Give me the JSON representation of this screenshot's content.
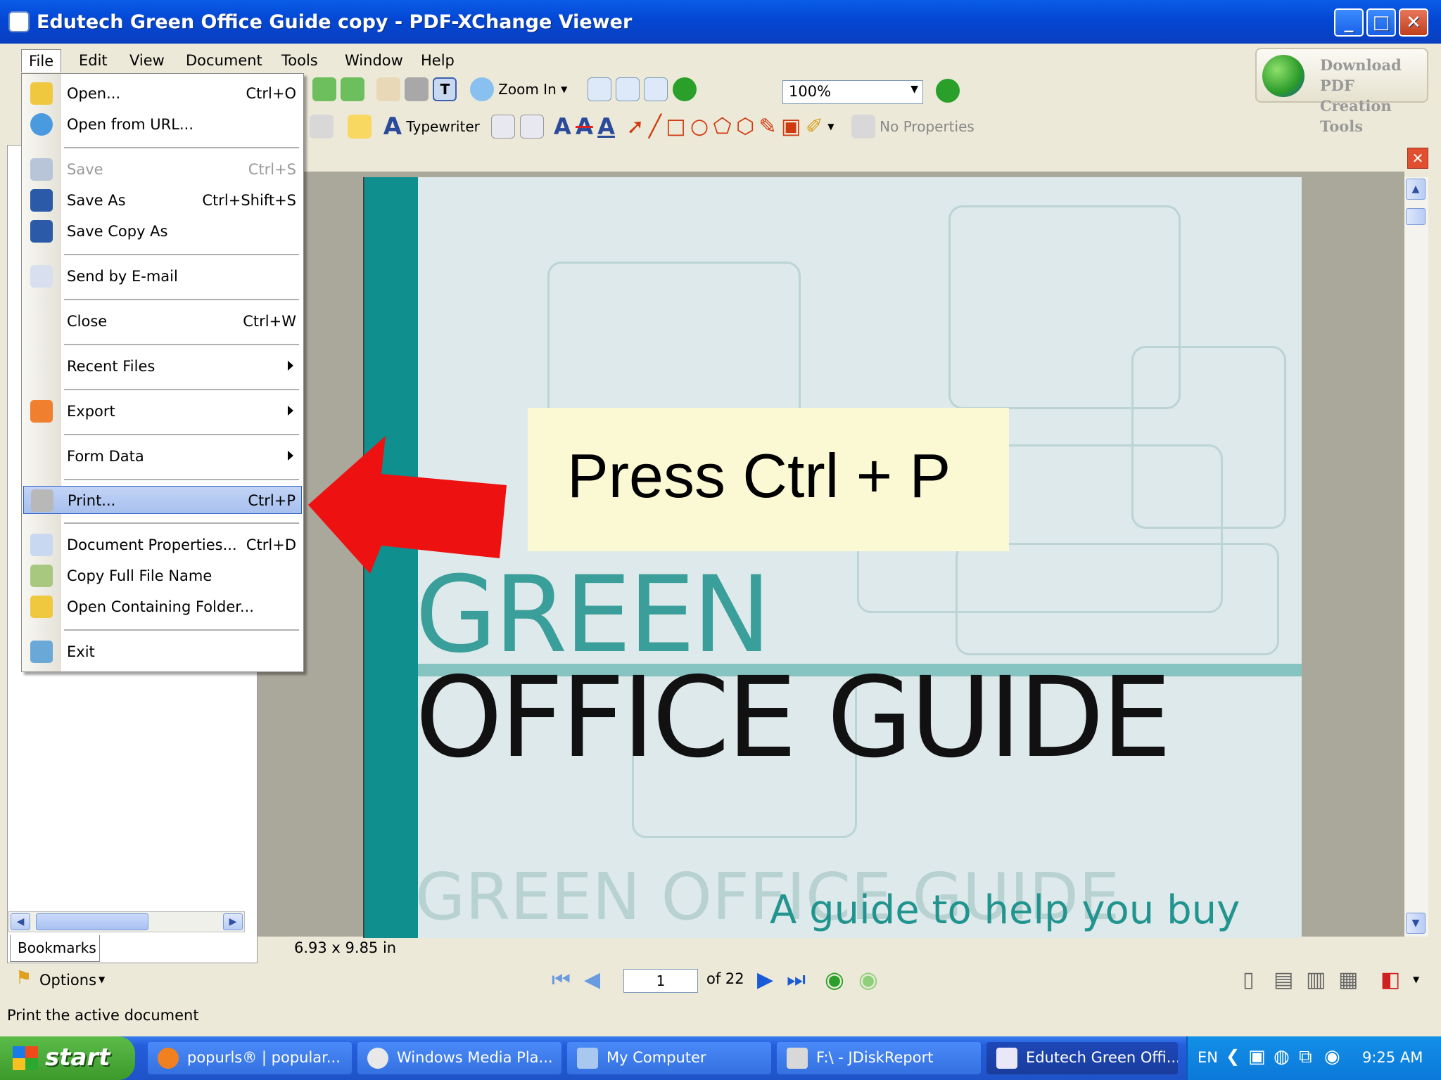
{
  "window": {
    "title": "Edutech Green Office Guide copy - PDF-XChange Viewer"
  },
  "menubar": [
    "File",
    "Edit",
    "View",
    "Document",
    "Tools",
    "Window",
    "Help"
  ],
  "toolbar": {
    "zoom_in_label": "Zoom In",
    "zoom_value": "100%",
    "typewriter_label": "Typewriter",
    "no_properties_label": "No Properties",
    "download_line1": "Download PDF",
    "download_line2": "Creation Tools"
  },
  "file_menu": {
    "open": {
      "label": "Open...",
      "shortcut": "Ctrl+O"
    },
    "open_url": {
      "label": "Open from URL..."
    },
    "save": {
      "label": "Save",
      "shortcut": "Ctrl+S"
    },
    "save_as": {
      "label": "Save As",
      "shortcut": "Ctrl+Shift+S"
    },
    "save_copy_as": {
      "label": "Save Copy As"
    },
    "send_email": {
      "label": "Send by E-mail"
    },
    "close": {
      "label": "Close",
      "shortcut": "Ctrl+W"
    },
    "recent_files": {
      "label": "Recent Files"
    },
    "export": {
      "label": "Export"
    },
    "form_data": {
      "label": "Form Data"
    },
    "print": {
      "label": "Print...",
      "shortcut": "Ctrl+P"
    },
    "doc_properties": {
      "label": "Document Properties...",
      "shortcut": "Ctrl+D"
    },
    "copy_full_name": {
      "label": "Copy Full File Name"
    },
    "open_folder": {
      "label": "Open Containing Folder..."
    },
    "exit": {
      "label": "Exit"
    }
  },
  "left_panel": {
    "tab_label": "Bookmarks",
    "options_label": "Options"
  },
  "document": {
    "page_size": "6.93 x 9.85 in",
    "title_word1": "GREEN",
    "title_word2": "OFFICE GUIDE",
    "watermark": "GREEN OFFICE GUIDE",
    "tagline": "A guide to help you buy"
  },
  "callout": {
    "text": "Press Ctrl + P"
  },
  "navigation": {
    "current_page": "1",
    "total_pages": "of 22"
  },
  "status": {
    "text": "Print the active document"
  },
  "taskbar": {
    "start_label": "start",
    "tasks": [
      "popurls® | popular...",
      "Windows Media Pla...",
      "My Computer",
      "F:\\ - JDiskReport",
      "Edutech Green Offi..."
    ],
    "language": "EN",
    "clock": "9:25 AM"
  },
  "colors": {
    "accent_teal": "#108f8f",
    "highlight_arrow": "#ee1111",
    "callout_bg": "#fbf9d4",
    "xp_blue": "#0347d3"
  }
}
